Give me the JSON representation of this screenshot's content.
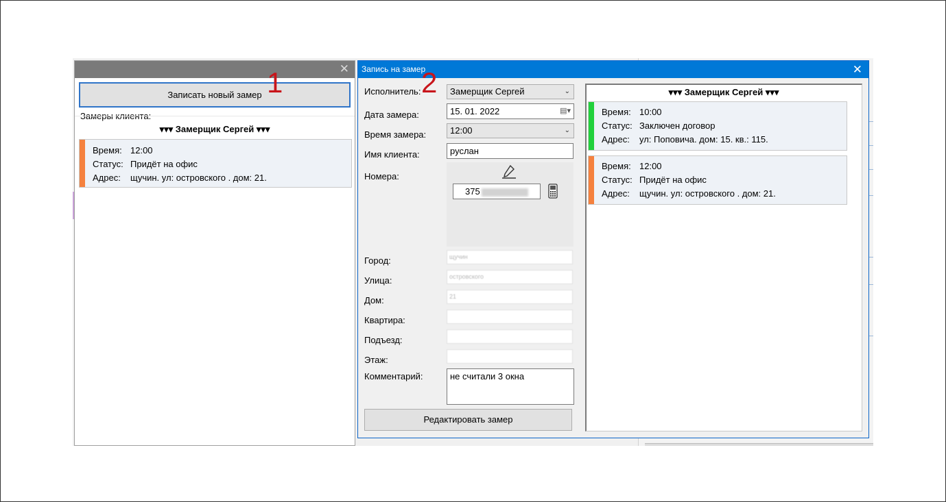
{
  "annotations": {
    "one": "1",
    "two": "2"
  },
  "left_window": {
    "close_glyph": "✕",
    "new_button": "Записать новый замер",
    "client_label": "Замеры клиента:",
    "worker_header": "▾▾▾ Замерщик Сергей ▾▾▾",
    "card": {
      "time_key": "Время:",
      "time": "12:00",
      "status_key": "Статус:",
      "status": "Придёт на офис",
      "addr_key": "Адрес:",
      "addr": "щучин. ул: островского . дом: 21.",
      "stripe_color": "#f5813e"
    }
  },
  "dialog": {
    "title": "Запись на замер",
    "close_glyph": "✕",
    "fields": {
      "executor_label": "Исполнитель:",
      "executor_value": "Замерщик Сергей",
      "date_label": "Дата замера:",
      "date_value": "15. 01. 2022",
      "time_label": "Время замера:",
      "time_value": "12:00",
      "client_label": "Имя клиента:",
      "client_value": "руслан",
      "phones_label": "Номера:",
      "phone_prefix": "375",
      "city_label": "Город:",
      "city_value": "щучин",
      "street_label": "Улица:",
      "street_value": "островского",
      "house_label": "Дом:",
      "house_value": "21",
      "flat_label": "Квартира:",
      "entrance_label": "Подъезд:",
      "floor_label": "Этаж:",
      "comment_label": "Комментарий:",
      "comment_value": "не считали 3 окна"
    },
    "edit_button": "Редактировать замер",
    "schedule": {
      "header": "▾▾▾ Замерщик Сергей ▾▾▾",
      "cards": [
        {
          "time_key": "Время:",
          "time": "10:00",
          "status_key": "Статус:",
          "status": "Заключен договор",
          "addr_key": "Адрес:",
          "addr": "ул: Поповича. дом: 15. кв.: 115.",
          "stripe_color": "#21d13c"
        },
        {
          "time_key": "Время:",
          "time": "12:00",
          "status_key": "Статус:",
          "status": "Придёт на офис",
          "addr_key": "Адрес:",
          "addr": "щучин. ул: островского . дом: 21.",
          "stripe_color": "#f5813e"
        }
      ]
    }
  }
}
